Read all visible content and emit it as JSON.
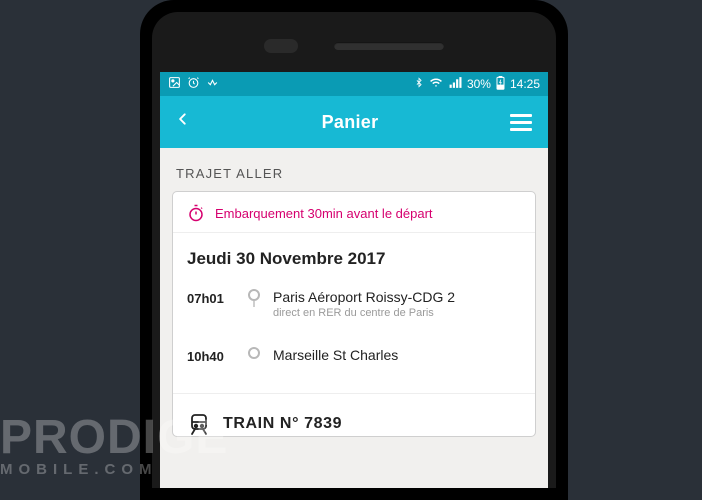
{
  "status_bar": {
    "battery_pct": "30%",
    "time": "14:25"
  },
  "app_bar": {
    "title": "Panier"
  },
  "section_label": "TRAJET ALLER",
  "boarding_notice": "Embarquement 30min avant le départ",
  "date_heading": "Jeudi 30 Novembre 2017",
  "stops": [
    {
      "time": "07h01",
      "name": "Paris Aéroport Roissy-CDG 2",
      "sub": "direct en RER du centre de Paris"
    },
    {
      "time": "10h40",
      "name": "Marseille St Charles",
      "sub": ""
    }
  ],
  "train_label": "TRAIN N° 7839",
  "watermark": {
    "line1": "PRODIGE",
    "line2": "MOBILE.COM"
  }
}
